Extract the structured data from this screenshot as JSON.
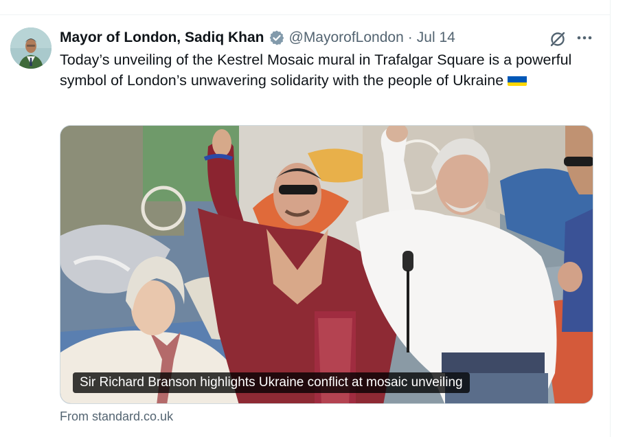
{
  "tweet": {
    "author_name": "Mayor of London, Sadiq Khan",
    "handle": "@MayorofLondon",
    "separator": "·",
    "date": "Jul 14",
    "text": "Today’s unveiling of the Kestrel Mosaic mural in Trafalgar Square is a powerful symbol of London’s unwavering solidarity with the people of Ukraine",
    "verified_color": "#829aab"
  },
  "media": {
    "caption": "Sir Richard Branson highlights Ukraine conflict at mosaic unveiling"
  },
  "link_source": "From standard.co.uk",
  "icons": {
    "verified": "verified-badge-icon",
    "grok": "grok-icon",
    "more": "more-dots-icon",
    "flag": "ukraine-flag-icon"
  },
  "colors": {
    "text_primary": "#0f1419",
    "text_secondary": "#536471",
    "divider": "#eff3f4",
    "flag_blue": "#0057b7",
    "flag_yellow": "#ffd700"
  }
}
